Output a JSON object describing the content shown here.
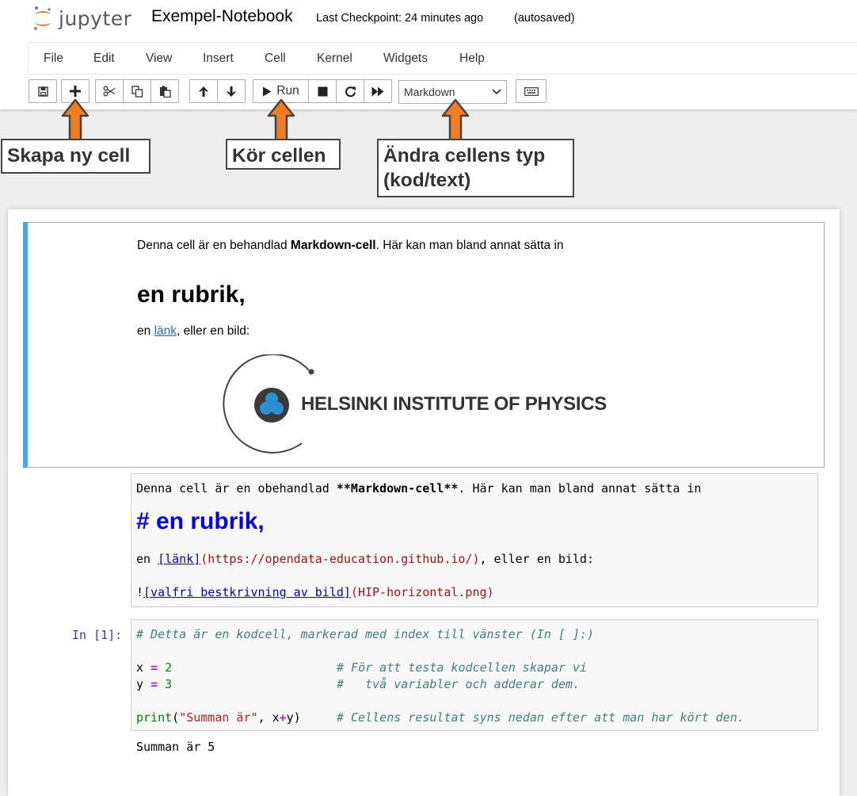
{
  "header": {
    "logo_text": "jupyter",
    "notebook_name": "Exempel-Notebook",
    "checkpoint": "Last Checkpoint: 24 minutes ago",
    "autosave": "(autosaved)"
  },
  "menu": [
    "File",
    "Edit",
    "View",
    "Insert",
    "Cell",
    "Kernel",
    "Widgets",
    "Help"
  ],
  "toolbar": {
    "run_label": "Run",
    "cell_type": "Markdown"
  },
  "annotations": {
    "new_cell": "Skapa ny cell",
    "run_cell": "Kör cellen",
    "change_type_line1": "Ändra cellens typ",
    "change_type_line2": "(kod/text)",
    "arrow_color": "#f47c20"
  },
  "rendered_md": {
    "p1_before": "Denna cell är en behandlad ",
    "p1_bold": "Markdown-cell",
    "p1_after": ". Här kan man bland annat sätta in",
    "heading": "en rubrik,",
    "p2_before": "en ",
    "p2_link": "länk",
    "p2_after": ", eller en bild:",
    "image_text": "HELSINKI INSTITUTE OF PHYSICS"
  },
  "raw_md": {
    "l1_before": "Denna cell är en obehandlad ",
    "l1_bold": "**Markdown-cell**",
    "l1_after": ". Här kan man bland annat sätta in",
    "heading": "# en rubrik,",
    "l3_before": "en ",
    "l3_link": "[länk]",
    "l3_url": "(https://opendata-education.github.io/)",
    "l3_after": ", eller en bild:",
    "l4_bang": "!",
    "l4_alt": "[valfri bestkrivning av bild]",
    "l4_src": "(HIP-horizontal.png)"
  },
  "code_cell": {
    "prompt": "In [1]:",
    "line1": "# Detta är en kodcell, markerad med index till vänster (In [ ]:)",
    "x_var": "x",
    "y_var": "y",
    "eq": "=",
    "x_val": "2",
    "y_val": "3",
    "comment2": "# För att testa kodcellen skapar vi",
    "comment3": "#   två variabler och adderar dem.",
    "print_fn": "print",
    "str": "\"Summan är\"",
    "args_mid": ", x",
    "plus": "+",
    "args_end": "y)",
    "comment4": "# Cellens resultat syns nedan efter att man har kört den.",
    "paren_open": "(",
    "output": "Summan är 5"
  }
}
